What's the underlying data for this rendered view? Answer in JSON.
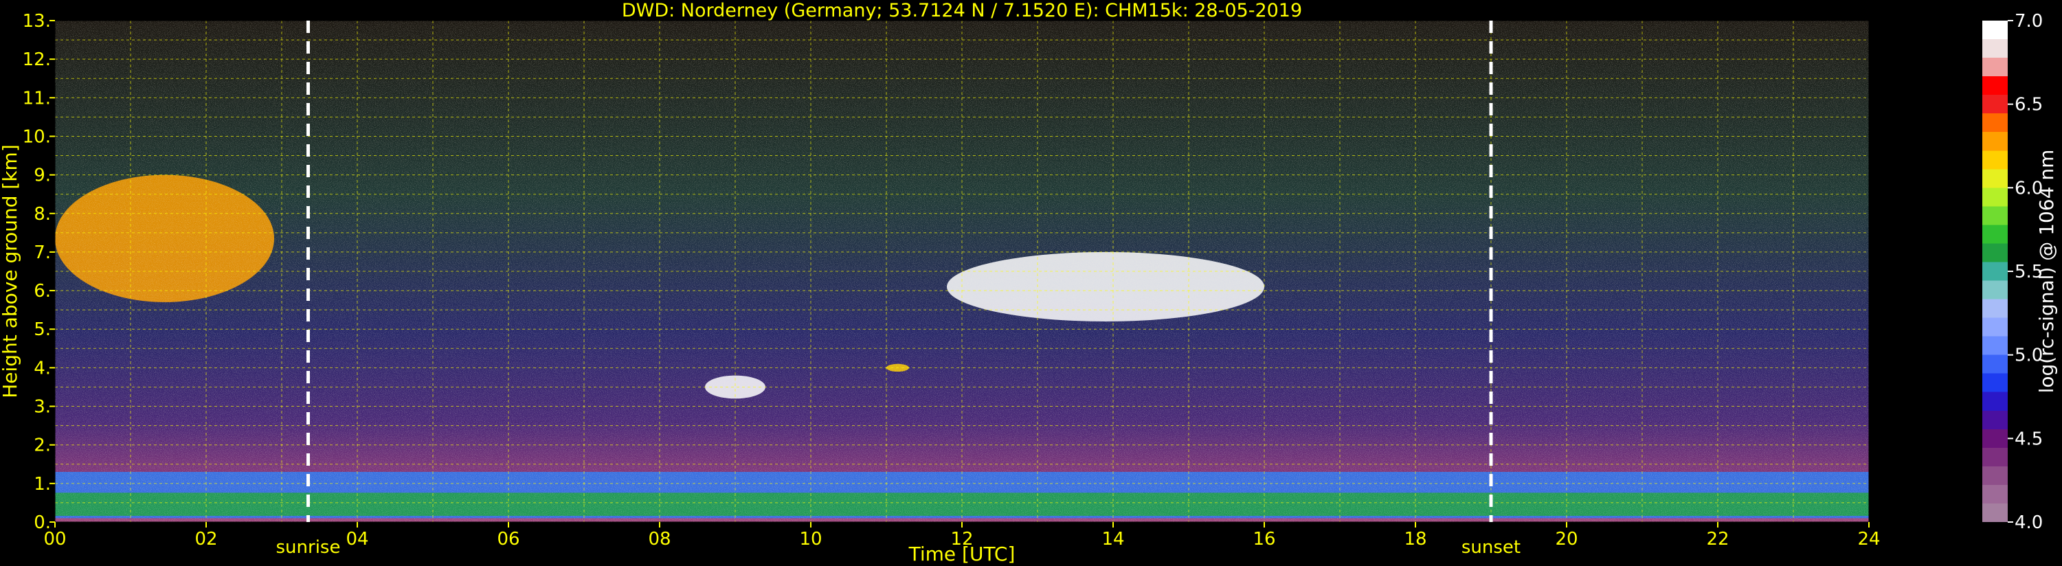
{
  "chart_data": {
    "type": "heatmap",
    "title": "DWD: Norderney (Germany; 53.7124 N / 7.1520 E):    CHM15k: 28-05-2019",
    "xlabel": "Time [UTC]",
    "ylabel": "Height above ground [km]",
    "xlim": [
      0,
      24
    ],
    "ylim": [
      0,
      13
    ],
    "x_ticks": [
      {
        "value": 0,
        "label": "00"
      },
      {
        "value": 2,
        "label": "02"
      },
      {
        "value": 4,
        "label": "04"
      },
      {
        "value": 6,
        "label": "06"
      },
      {
        "value": 8,
        "label": "08"
      },
      {
        "value": 10,
        "label": "10"
      },
      {
        "value": 12,
        "label": "12"
      },
      {
        "value": 14,
        "label": "14"
      },
      {
        "value": 16,
        "label": "16"
      },
      {
        "value": 18,
        "label": "18"
      },
      {
        "value": 20,
        "label": "20"
      },
      {
        "value": 22,
        "label": "22"
      },
      {
        "value": 24,
        "label": "24"
      }
    ],
    "y_ticks": [
      {
        "value": 0,
        "label": "0."
      },
      {
        "value": 1,
        "label": "1."
      },
      {
        "value": 2,
        "label": "2."
      },
      {
        "value": 3,
        "label": "3."
      },
      {
        "value": 4,
        "label": "4."
      },
      {
        "value": 5,
        "label": "5."
      },
      {
        "value": 6,
        "label": "6."
      },
      {
        "value": 7,
        "label": "7."
      },
      {
        "value": 8,
        "label": "8."
      },
      {
        "value": 9,
        "label": "9."
      },
      {
        "value": 10,
        "label": "10."
      },
      {
        "value": 11,
        "label": "11."
      },
      {
        "value": 12,
        "label": "12."
      },
      {
        "value": 13,
        "label": "13."
      }
    ],
    "grid": true,
    "annotations": [
      {
        "label": "sunrise",
        "x": 3.35
      },
      {
        "label": "sunset",
        "x": 19.0
      }
    ],
    "colorbar": {
      "label": "log(rc-signal) @ 1064 nm",
      "range": [
        4.0,
        7.0
      ],
      "ticks": [
        {
          "value": 4.0,
          "label": "4.0"
        },
        {
          "value": 4.5,
          "label": "4.5"
        },
        {
          "value": 5.0,
          "label": "5.0"
        },
        {
          "value": 5.5,
          "label": "5.5"
        },
        {
          "value": 6.0,
          "label": "6.0"
        },
        {
          "value": 6.5,
          "label": "6.5"
        },
        {
          "value": 7.0,
          "label": "7.0"
        }
      ],
      "colors": [
        "#a57fa0",
        "#9e6a98",
        "#8f4f8a",
        "#7d2f7f",
        "#6a137a",
        "#4a10a0",
        "#2a18c8",
        "#1e3cf0",
        "#3c64f8",
        "#6a8cff",
        "#90a8ff",
        "#a8bcf8",
        "#7fc8c8",
        "#3cb0a0",
        "#20a040",
        "#30c030",
        "#70dc30",
        "#b4f028",
        "#e6f020",
        "#ffd000",
        "#ffa000",
        "#ff6a00",
        "#f02020",
        "#ff0000",
        "#f0a0a0",
        "#f0e0e0",
        "#ffffff"
      ]
    },
    "features": [
      {
        "name": "boundary_layer",
        "x_range": [
          0,
          24
        ],
        "height_range": [
          0.1,
          1.3
        ],
        "log_signal": 5.6
      },
      {
        "name": "cirrus_morning",
        "x_range": [
          0,
          2.9
        ],
        "height_range": [
          5.7,
          9.0
        ],
        "log_signal": 6.3
      },
      {
        "name": "cirrus_midday",
        "x_range": [
          11.8,
          16.0
        ],
        "height_range": [
          5.2,
          7.0
        ],
        "log_signal": 6.9
      },
      {
        "name": "cloud_patch",
        "x_range": [
          8.6,
          9.4
        ],
        "height_range": [
          3.2,
          3.8
        ],
        "log_signal": 6.9
      },
      {
        "name": "cloud_patch_small",
        "x_range": [
          11.0,
          11.3
        ],
        "height_range": [
          3.9,
          4.1
        ],
        "log_signal": 6.2
      }
    ]
  }
}
